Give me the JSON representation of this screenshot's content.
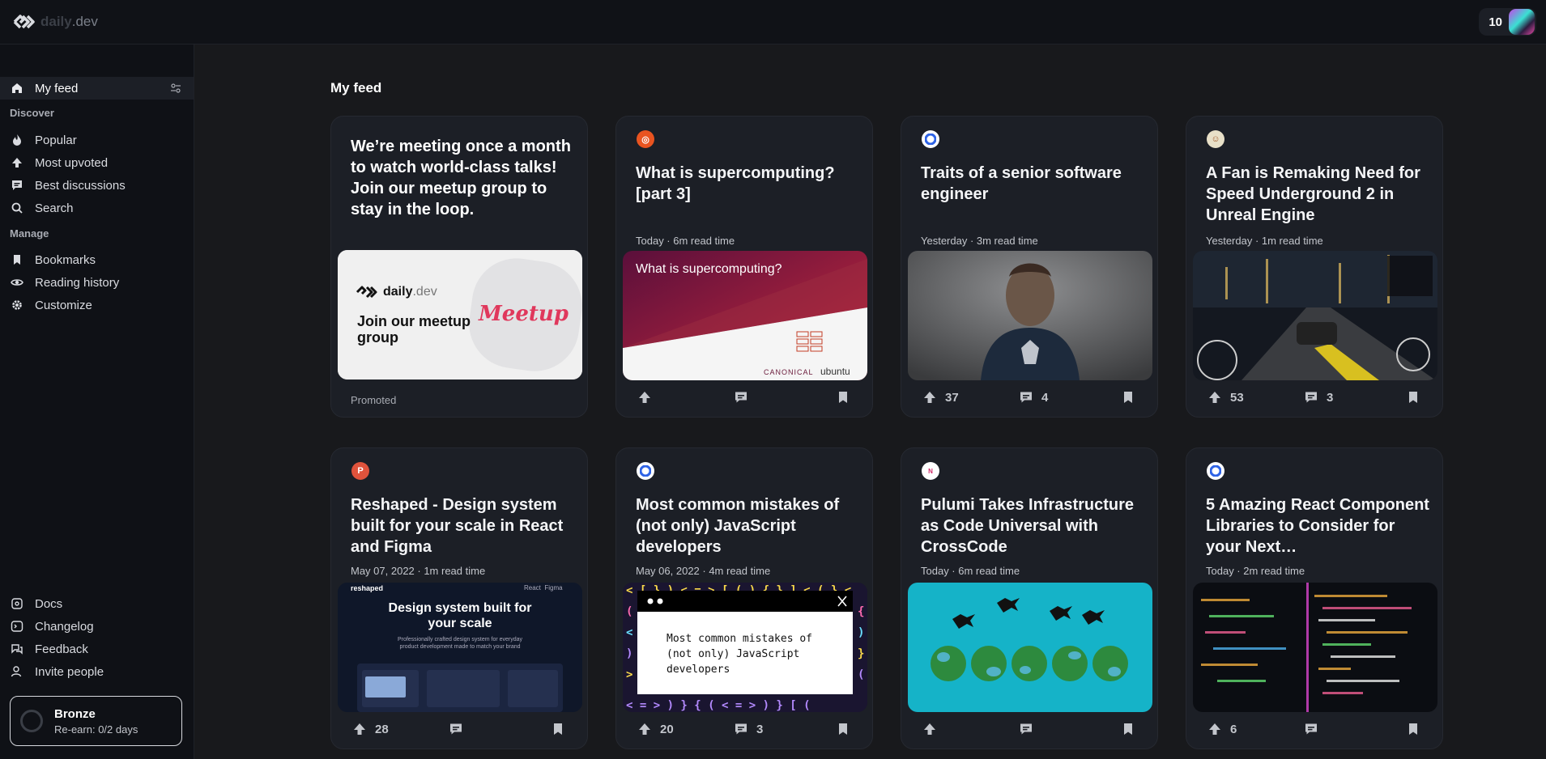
{
  "header": {
    "logo_text": "daily",
    "logo_suffix": ".dev",
    "reputation": "10"
  },
  "sidebar": {
    "my_feed": "My feed",
    "discover_label": "Discover",
    "discover": [
      {
        "label": "Popular",
        "icon": "flame-icon"
      },
      {
        "label": "Most upvoted",
        "icon": "upvote-icon"
      },
      {
        "label": "Best discussions",
        "icon": "discussion-icon"
      },
      {
        "label": "Search",
        "icon": "search-icon"
      }
    ],
    "manage_label": "Manage",
    "manage": [
      {
        "label": "Bookmarks",
        "icon": "bookmark-icon"
      },
      {
        "label": "Reading history",
        "icon": "eye-icon"
      },
      {
        "label": "Customize",
        "icon": "gear-icon"
      }
    ],
    "footer": [
      {
        "label": "Docs",
        "icon": "docs-icon"
      },
      {
        "label": "Changelog",
        "icon": "terminal-icon"
      },
      {
        "label": "Feedback",
        "icon": "feedback-icon"
      },
      {
        "label": "Invite people",
        "icon": "invite-icon"
      }
    ],
    "level": {
      "name": "Bronze",
      "sub": "Re-earn: 0/2 days"
    }
  },
  "main": {
    "title": "My feed",
    "promo": {
      "title": "We’re meeting once a month to watch world-class talks! Join our meetup group to stay in the loop.",
      "image_logo": "daily",
      "image_logo_suffix": ".dev",
      "image_heading": "Join our meetup group",
      "image_badge": "Meetup",
      "label": "Promoted"
    },
    "cards": [
      {
        "source_color": "#e95420",
        "source_glyph": "◎",
        "title": "What is supercomputing? [part 3]",
        "meta": "Today · 6m read time",
        "upvotes": "",
        "comments": "",
        "image_text": "What is supercomputing?",
        "image_brand1": "CANONICAL",
        "image_brand2": "ubuntu"
      },
      {
        "source_color": "#ffffff",
        "source_glyph": "●",
        "title": "Traits of a senior software engineer",
        "meta": "Yesterday · 3m read time",
        "upvotes": "37",
        "comments": "4"
      },
      {
        "source_color": "#e8e0c8",
        "source_glyph": "☺",
        "title": "A Fan is Remaking Need for Speed Underground 2 in Unreal Engine",
        "meta": "Yesterday · 1m read time",
        "upvotes": "53",
        "comments": "3"
      },
      {
        "source_color": "#e0533c",
        "source_glyph": "P",
        "title": "Reshaped - Design system built for your scale in React and Figma",
        "meta": "May 07, 2022 · 1m read time",
        "upvotes": "28",
        "comments": "",
        "image_brand": "reshaped",
        "image_tag1": "React",
        "image_tag2": "Figma",
        "image_heading": "Design system built for your scale",
        "image_sub": "Professionally crafted design system for everyday product development made to match your brand"
      },
      {
        "source_color": "#ffffff",
        "source_glyph": "●",
        "title": "Most common mistakes of (not only) JavaScript developers",
        "meta": "May 06, 2022 · 4m read time",
        "upvotes": "20",
        "comments": "3",
        "image_text": "Most common mistakes of (not only) JavaScript developers"
      },
      {
        "source_color": "#ffffff",
        "source_glyph": "N",
        "title": "Pulumi Takes Infrastructure as Code Universal with CrossCode",
        "meta": "Today · 6m read time",
        "upvotes": "",
        "comments": ""
      },
      {
        "source_color": "#ffffff",
        "source_glyph": "●",
        "title": "5 Amazing React Component Libraries to Consider for your Next…",
        "meta": "Today · 2m read time",
        "upvotes": "6",
        "comments": ""
      }
    ]
  }
}
